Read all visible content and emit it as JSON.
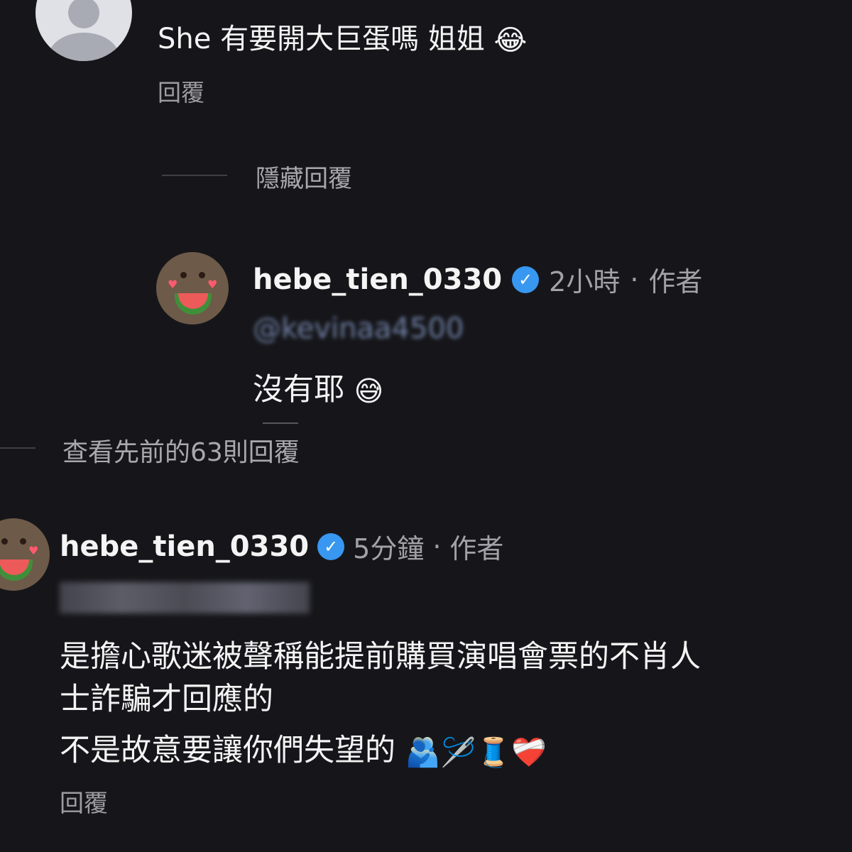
{
  "top_comment": {
    "text": "She 有要開大巨蛋嗎 姐姐",
    "emoji": "😂",
    "reply_label": "回覆"
  },
  "hide_replies": "隱藏回覆",
  "author_reply": {
    "username": "hebe_tien_0330",
    "time": "2小時",
    "separator": "·",
    "role": "作者",
    "mention": "@kevinaa4500",
    "text": "沒有耶",
    "emoji": "😅"
  },
  "view_previous": "查看先前的63則回覆",
  "main_comment": {
    "username": "hebe_tien_0330",
    "time": "5分鐘",
    "separator": "·",
    "role": "作者",
    "line1": "是擔心歌迷被聲稱能提前購買演唱會票的不肖人",
    "line2": "士詐騙才回應的",
    "line3": "不是故意要讓你們失望的",
    "emojis": "🫂🪡🧵❤️‍🩹",
    "reply_label": "回覆"
  },
  "icons": {
    "verified": "verified-badge-icon",
    "default_avatar": "default-avatar-icon"
  },
  "colors": {
    "background": "#16161a",
    "verified": "#3897f0",
    "secondary_text": "#a1a1a8"
  }
}
